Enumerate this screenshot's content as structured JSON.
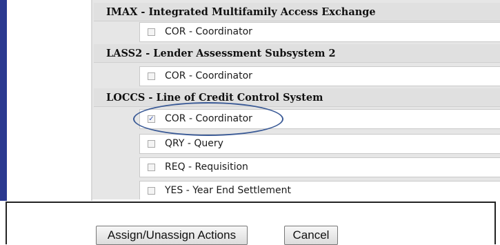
{
  "systems": [
    {
      "header": "IMAX  -  Integrated Multifamily Access Exchange",
      "actions": [
        {
          "label": "COR  -  Coordinator",
          "checked": false
        }
      ]
    },
    {
      "header": "LASS2  -  Lender Assessment Subsystem 2",
      "actions": [
        {
          "label": "COR  -  Coordinator",
          "checked": false
        }
      ]
    },
    {
      "header": "LOCCS  -  Line of Credit Control System",
      "actions": [
        {
          "label": "COR  -  Coordinator",
          "checked": true,
          "highlighted": true
        },
        {
          "label": "QRY  -  Query",
          "checked": false
        },
        {
          "label": "REQ  -  Requisition",
          "checked": false
        },
        {
          "label": "YES  -  Year End Settlement",
          "checked": false
        }
      ]
    }
  ],
  "buttons": {
    "assign_label": "Assign/Unassign Actions",
    "cancel_label": "Cancel"
  },
  "colors": {
    "frame_accent": "#2b3990",
    "highlight_ellipse": "#3a5a96"
  }
}
